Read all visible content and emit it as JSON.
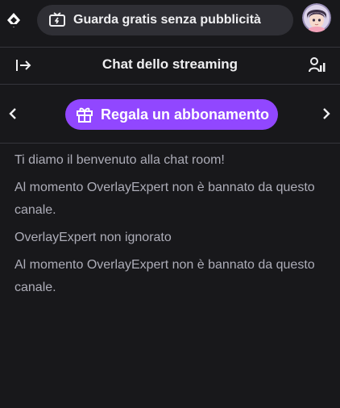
{
  "topbar": {
    "ad_free_label": "Guarda gratis senza pubblicità",
    "logo_icon": "prime-crown-icon",
    "tv_icon": "tv-icon",
    "avatar_icon": "user-avatar"
  },
  "chat": {
    "title": "Chat dello streaming",
    "collapse_icon": "collapse-right-icon",
    "users_icon": "community-users-icon"
  },
  "subscription": {
    "gift_label": "Regala un abbonamento",
    "gift_icon": "gift-icon",
    "prev_icon": "chevron-left-icon",
    "next_icon": "chevron-right-icon"
  },
  "messages": [
    "Ti diamo il benvenuto alla chat room!",
    "Al momento OverlayExpert non è bannato da questo canale.",
    "OverlayExpert non ignorato",
    "Al momento OverlayExpert non è bannato da questo canale."
  ],
  "colors": {
    "background": "#18181b",
    "accent_purple": "#9147ff",
    "button_gray": "#2f2f35",
    "text_primary": "#efeff1",
    "text_secondary": "#adadb8"
  }
}
